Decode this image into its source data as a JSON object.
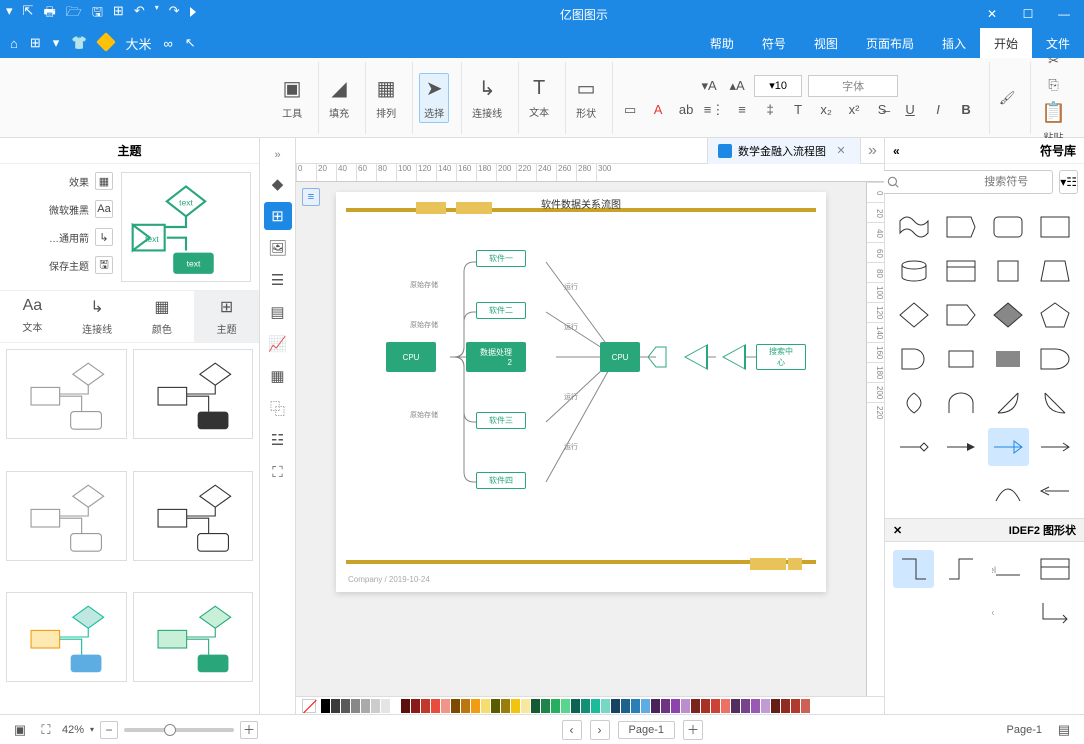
{
  "titlebar": {
    "app_title": "亿图图示"
  },
  "menubar": {
    "tabs": [
      "文件",
      "开始",
      "插入",
      "页面布局",
      "视图",
      "符号",
      "帮助"
    ],
    "active_index": 1,
    "quick_user": "大米"
  },
  "ribbon": {
    "clipboard": {
      "paste": "粘贴"
    },
    "font": {
      "size": "10",
      "name_placeholder": "字体"
    },
    "groups": {
      "style": "形状",
      "text": "文本",
      "connector": "连接线",
      "select": "选择",
      "align": "排列",
      "fill": "填充",
      "tools": "工具"
    }
  },
  "doc_tab": {
    "name": "数学金融入流程图"
  },
  "shapes_panel": {
    "title": "符号库",
    "search_placeholder": "搜索符号",
    "section2": "IDEF2 图形状"
  },
  "theme_panel": {
    "title": "主题",
    "opts": [
      "效果",
      "微软雅黑",
      "通用箭…",
      "保存主题"
    ],
    "tabs": [
      "主题",
      "颜色",
      "连接线",
      "文本"
    ],
    "active_tab": 0
  },
  "canvas": {
    "diagram_title": "软件数据关系流图",
    "copyright": "Company / 2019-10-24",
    "nodes": {
      "search": "搜索中\n心",
      "cpu": "CPU",
      "processor": "数据处理\n2",
      "proc_cpu": "CPU",
      "s1": "软件一",
      "s2": "软件二",
      "s3": "软件三",
      "s4": "软件四"
    },
    "edge_labels": {
      "run": "运行",
      "store": "原始存储"
    }
  },
  "ruler_h": [
    "0",
    "20",
    "40",
    "60",
    "80",
    "100",
    "120",
    "140",
    "160",
    "180",
    "200",
    "220",
    "240",
    "260",
    "280",
    "300"
  ],
  "ruler_v": [
    "0",
    "20",
    "40",
    "60",
    "80",
    "100",
    "120",
    "140",
    "160",
    "180",
    "200",
    "220"
  ],
  "colorbar": [
    "#000000",
    "#3b3b3b",
    "#5a5a5a",
    "#888888",
    "#aaaaaa",
    "#cccccc",
    "#e5e5e5",
    "#ffffff",
    "#5b0f0f",
    "#8b1a1a",
    "#c0392b",
    "#e74c3c",
    "#f1948a",
    "#7e4a00",
    "#b9770e",
    "#f39c12",
    "#f7dc6f",
    "#5b5b00",
    "#9a7d0a",
    "#f1c40f",
    "#f9e79f",
    "#145a32",
    "#1e8449",
    "#27ae60",
    "#58d68d",
    "#0e6251",
    "#148f77",
    "#1abc9c",
    "#76d7c4",
    "#154360",
    "#1f618d",
    "#2980b9",
    "#5dade2",
    "#4a235a",
    "#6c3483",
    "#8e44ad",
    "#bb8fce",
    "#7b241c",
    "#a93226",
    "#cb4335",
    "#ec7063",
    "#512e5f",
    "#76448a",
    "#9b59b6",
    "#c39bd3",
    "#641e16",
    "#922b21",
    "#b03a2e",
    "#cd6155"
  ],
  "statusbar": {
    "page_list_label": "Page-1",
    "page_current": "Page-1",
    "zoom_pct": "42%"
  }
}
